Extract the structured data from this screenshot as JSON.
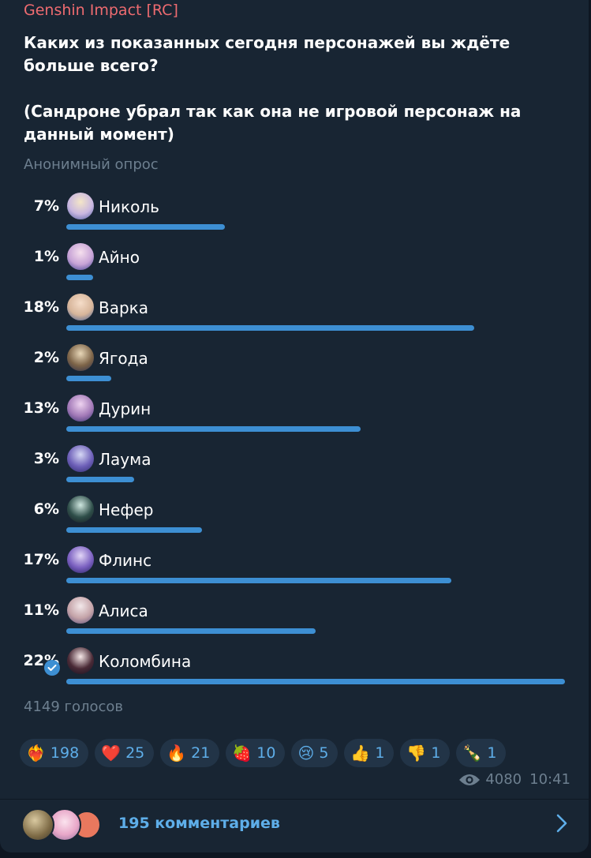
{
  "channel": {
    "name": "Genshin Impact [RC]"
  },
  "poll": {
    "question_line1": "Каких из показанных сегодня персонажей вы ждёте больше всего?",
    "question_line2": "(Сандроне убрал так как она не игровой персонаж на данный момент)",
    "type_label": "Анонимный опрос",
    "total_votes": "4149 голосов",
    "options": [
      {
        "percent": "7%",
        "fraction": 0.07,
        "name": "Николь"
      },
      {
        "percent": "1%",
        "fraction": 0.01,
        "name": "Айно"
      },
      {
        "percent": "18%",
        "fraction": 0.18,
        "name": "Варка"
      },
      {
        "percent": "2%",
        "fraction": 0.02,
        "name": "Ягода"
      },
      {
        "percent": "13%",
        "fraction": 0.13,
        "name": "Дурин"
      },
      {
        "percent": "3%",
        "fraction": 0.03,
        "name": "Лаума"
      },
      {
        "percent": "6%",
        "fraction": 0.06,
        "name": "Нефер"
      },
      {
        "percent": "17%",
        "fraction": 0.17,
        "name": "Флинс"
      },
      {
        "percent": "11%",
        "fraction": 0.11,
        "name": "Алиса"
      },
      {
        "percent": "22%",
        "fraction": 0.22,
        "name": "Коломбина",
        "voted": true
      }
    ]
  },
  "reactions": [
    {
      "emoji": "❤️‍🔥",
      "icon": "heart-on-fire-icon",
      "count": "198"
    },
    {
      "emoji": "❤️",
      "icon": "heart-icon",
      "count": "25"
    },
    {
      "emoji": "🔥",
      "icon": "fire-icon",
      "count": "21"
    },
    {
      "emoji": "🍓",
      "icon": "strawberry-icon",
      "count": "10"
    },
    {
      "emoji": "😢",
      "icon": "crying-face-icon",
      "count": "5"
    },
    {
      "emoji": "👍",
      "icon": "thumbs-up-icon",
      "count": "1"
    },
    {
      "emoji": "👎",
      "icon": "thumbs-down-icon",
      "count": "1"
    },
    {
      "emoji": "🍾",
      "icon": "champagne-icon",
      "count": "1"
    }
  ],
  "meta": {
    "views": "4080",
    "time": "10:41"
  },
  "comments": {
    "label": "195 комментариев"
  },
  "colors": {
    "accent": "#3d8fd3",
    "channel_name": "#ee6b70",
    "bubble": "#182533",
    "muted": "#6d7f8f"
  }
}
